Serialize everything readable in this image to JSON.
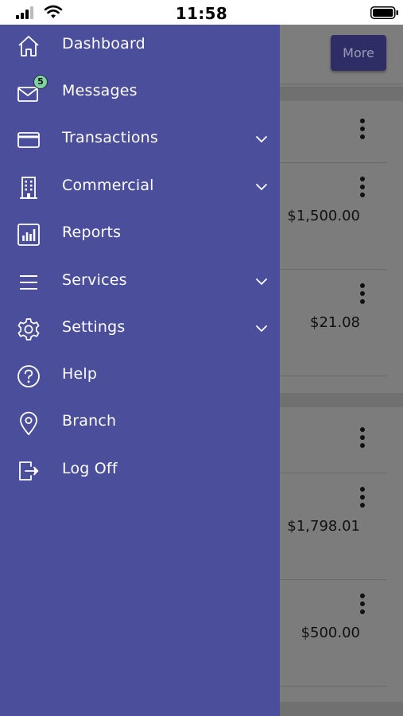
{
  "status_bar": {
    "time": "11:58"
  },
  "background": {
    "more_button": "More",
    "amounts": [
      "$1,500.00",
      "$21.08",
      "$1,798.01",
      "$500.00"
    ]
  },
  "drawer": {
    "items": [
      {
        "label": "Dashboard",
        "icon": "home-icon",
        "expandable": false
      },
      {
        "label": "Messages",
        "icon": "envelope-icon",
        "expandable": false,
        "badge": "5"
      },
      {
        "label": "Transactions",
        "icon": "credit-card-icon",
        "expandable": true
      },
      {
        "label": "Commercial",
        "icon": "building-icon",
        "expandable": true
      },
      {
        "label": "Reports",
        "icon": "bar-chart-icon",
        "expandable": false
      },
      {
        "label": "Services",
        "icon": "hamburger-icon",
        "expandable": true
      },
      {
        "label": "Settings",
        "icon": "gear-icon",
        "expandable": true
      },
      {
        "label": "Help",
        "icon": "question-circle-icon",
        "expandable": false
      },
      {
        "label": "Branch",
        "icon": "map-pin-icon",
        "expandable": false
      },
      {
        "label": "Log Off",
        "icon": "logout-icon",
        "expandable": false
      }
    ]
  },
  "colors": {
    "drawer_bg": "#4b4e9a",
    "badge": "#7fd3a0",
    "more_button": "#2e2d66"
  }
}
